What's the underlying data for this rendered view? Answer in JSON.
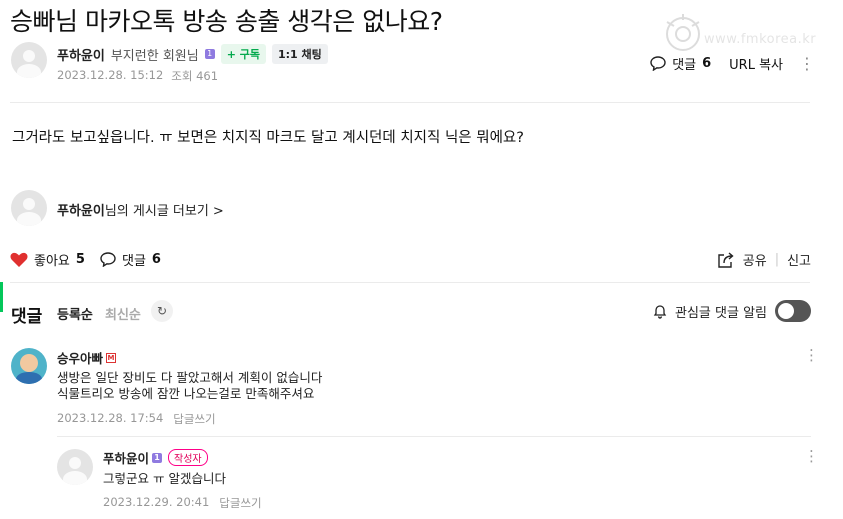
{
  "post": {
    "title": "승빠님 마카오톡 방송 송출 생각은 없나요?",
    "author": "푸하윤이",
    "grade": "부지런한 회원님",
    "subscribe_label": "+ 구독",
    "chat_label": "1:1 채팅",
    "date": "2023.12.28. 15:12",
    "views": "조회 461",
    "comment_label": "댓글",
    "comment_count": "6",
    "url_copy": "URL 복사",
    "content": "그거라도 보고싶읍니다. ㅠ 보면은 치지직 마크도 달고 계시던데 치지직 닉은 뭐에요?",
    "more_posts_name": "푸하윤이",
    "more_posts_suffix": "님의 게시글 더보기 >"
  },
  "watermark": {
    "text": "www.fmkorea.kr"
  },
  "reactions": {
    "like_label": "좋아요",
    "like_count": "5",
    "comment_label": "댓글",
    "comment_count": "6",
    "share_label": "공유",
    "report_label": "신고"
  },
  "comments_section": {
    "title": "댓글",
    "sort_register": "등록순",
    "sort_latest": "최신순",
    "alarm_label": "관심글 댓글 알림"
  },
  "comments": [
    {
      "name": "승우아빠",
      "line1": "생방은 일단 장비도 다 팔았고해서 계획이 없습니다",
      "line2": "식물트리오 방송에 잠깐 나오는걸로 만족해주셔요",
      "date": "2023.12.28. 17:54",
      "reply_label": "답글쓰기"
    },
    {
      "name": "푸하윤이",
      "tag": "작성자",
      "line1": "그렇군요 ㅠ 알겠습니다",
      "date": "2023.12.29. 20:41",
      "reply_label": "답글쓰기"
    }
  ],
  "colors": {
    "accent": "#03c75a",
    "like": "#e0302f",
    "author_tag": "#e0005a"
  },
  "icons": [
    "more-icon",
    "comment-icon",
    "heart-icon",
    "share-icon",
    "refresh-icon",
    "bell-icon"
  ]
}
